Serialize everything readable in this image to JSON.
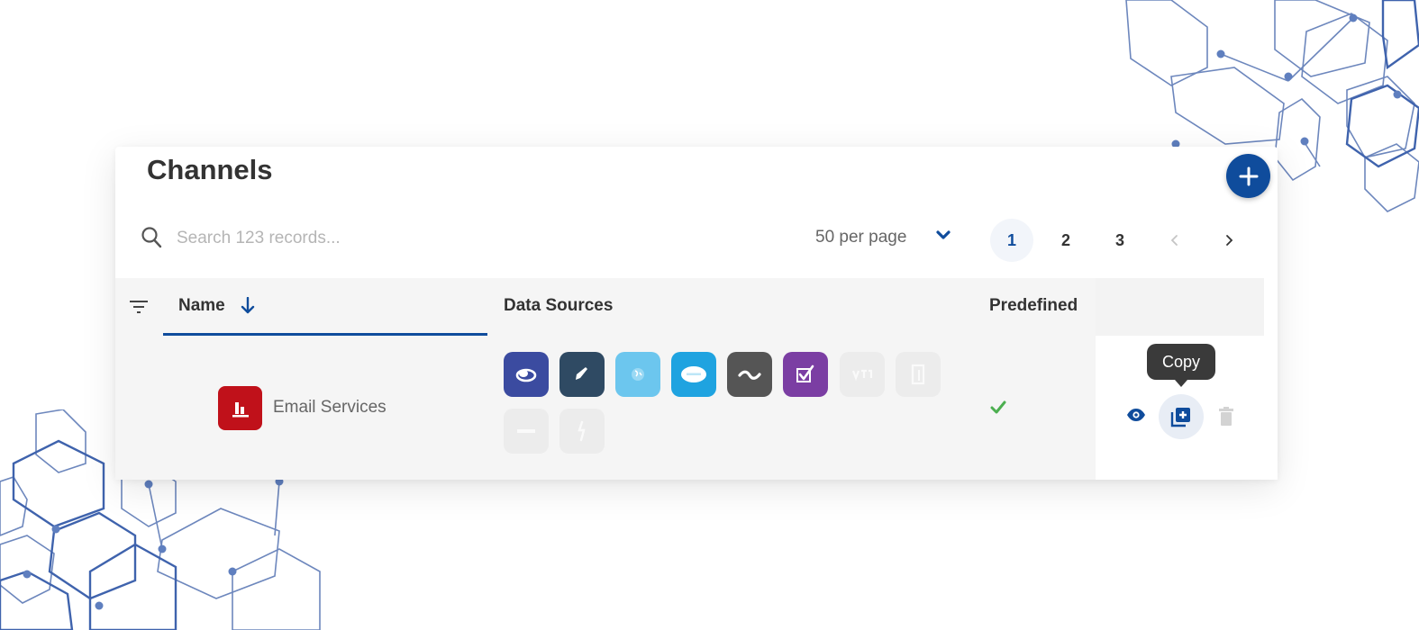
{
  "page": {
    "title": "Channels"
  },
  "toolbar": {
    "search_placeholder": "Search 123 records...",
    "per_page_label": "50 per page",
    "pages": [
      "1",
      "2",
      "3"
    ],
    "active_page": "1"
  },
  "table": {
    "columns": {
      "name": "Name",
      "data_sources": "Data Sources",
      "predefined": "Predefined"
    },
    "rows": [
      {
        "name": "Email Services",
        "logo_icon": "bar-chart-icon",
        "logo_color": "#c0111a",
        "predefined": true,
        "data_sources": [
          {
            "icon": "cloud-icon",
            "color": "#3b4ba0",
            "enabled": true
          },
          {
            "icon": "rocket-icon",
            "color": "#2f4a63",
            "enabled": true
          },
          {
            "icon": "globe-icon",
            "color": "#6cc6ee",
            "enabled": true
          },
          {
            "icon": "salesforce-icon",
            "color": "#1fa3e0",
            "enabled": true
          },
          {
            "icon": "wave-icon",
            "color": "#555555",
            "enabled": true
          },
          {
            "icon": "checkbox-icon",
            "color": "#7b3ea3",
            "enabled": true
          },
          {
            "icon": "vtr-icon",
            "color": "#ececec",
            "enabled": false
          },
          {
            "icon": "document-icon",
            "color": "#ececec",
            "enabled": false
          },
          {
            "icon": "minus-icon",
            "color": "#ececec",
            "enabled": false
          },
          {
            "icon": "bolt-icon",
            "color": "#ececec",
            "enabled": false
          }
        ]
      }
    ]
  },
  "tooltip": {
    "text": "Copy"
  },
  "colors": {
    "accent": "#0f4c9c",
    "check": "#4caf50"
  }
}
